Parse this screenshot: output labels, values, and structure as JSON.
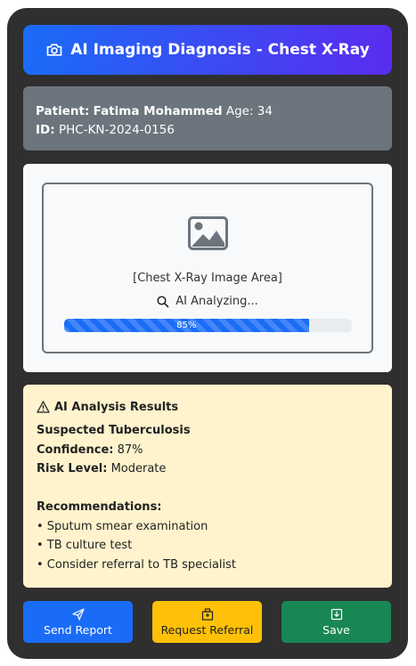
{
  "header": {
    "title": "AI Imaging Diagnosis - Chest X-Ray",
    "icon": "camera-icon"
  },
  "patient": {
    "name_label": "Patient:",
    "name": "Fatima Mohammed",
    "age_label": "Age:",
    "age": "34",
    "id_label": "ID:",
    "id": "PHC-KN-2024-0156"
  },
  "imaging": {
    "placeholder": "[Chest X-Ray Image Area]",
    "status": "AI Analyzing...",
    "progress_label": "85%",
    "progress_value": 0.85
  },
  "results": {
    "title": "AI Analysis Results",
    "diagnosis": "Suspected Tuberculosis",
    "confidence_label": "Confidence:",
    "confidence": "87%",
    "risk_label": "Risk Level:",
    "risk": "Moderate",
    "recommendations_label": "Recommendations:",
    "recommendations": [
      "• Sputum smear examination",
      "• TB culture test",
      "• Consider referral to TB specialist"
    ]
  },
  "actions": {
    "send": "Send Report",
    "referral": "Request Referral",
    "save": "Save"
  },
  "colors": {
    "primary": "#1a6cf7",
    "warning": "#ffc107",
    "success": "#198754",
    "secondary": "#6c757d"
  }
}
